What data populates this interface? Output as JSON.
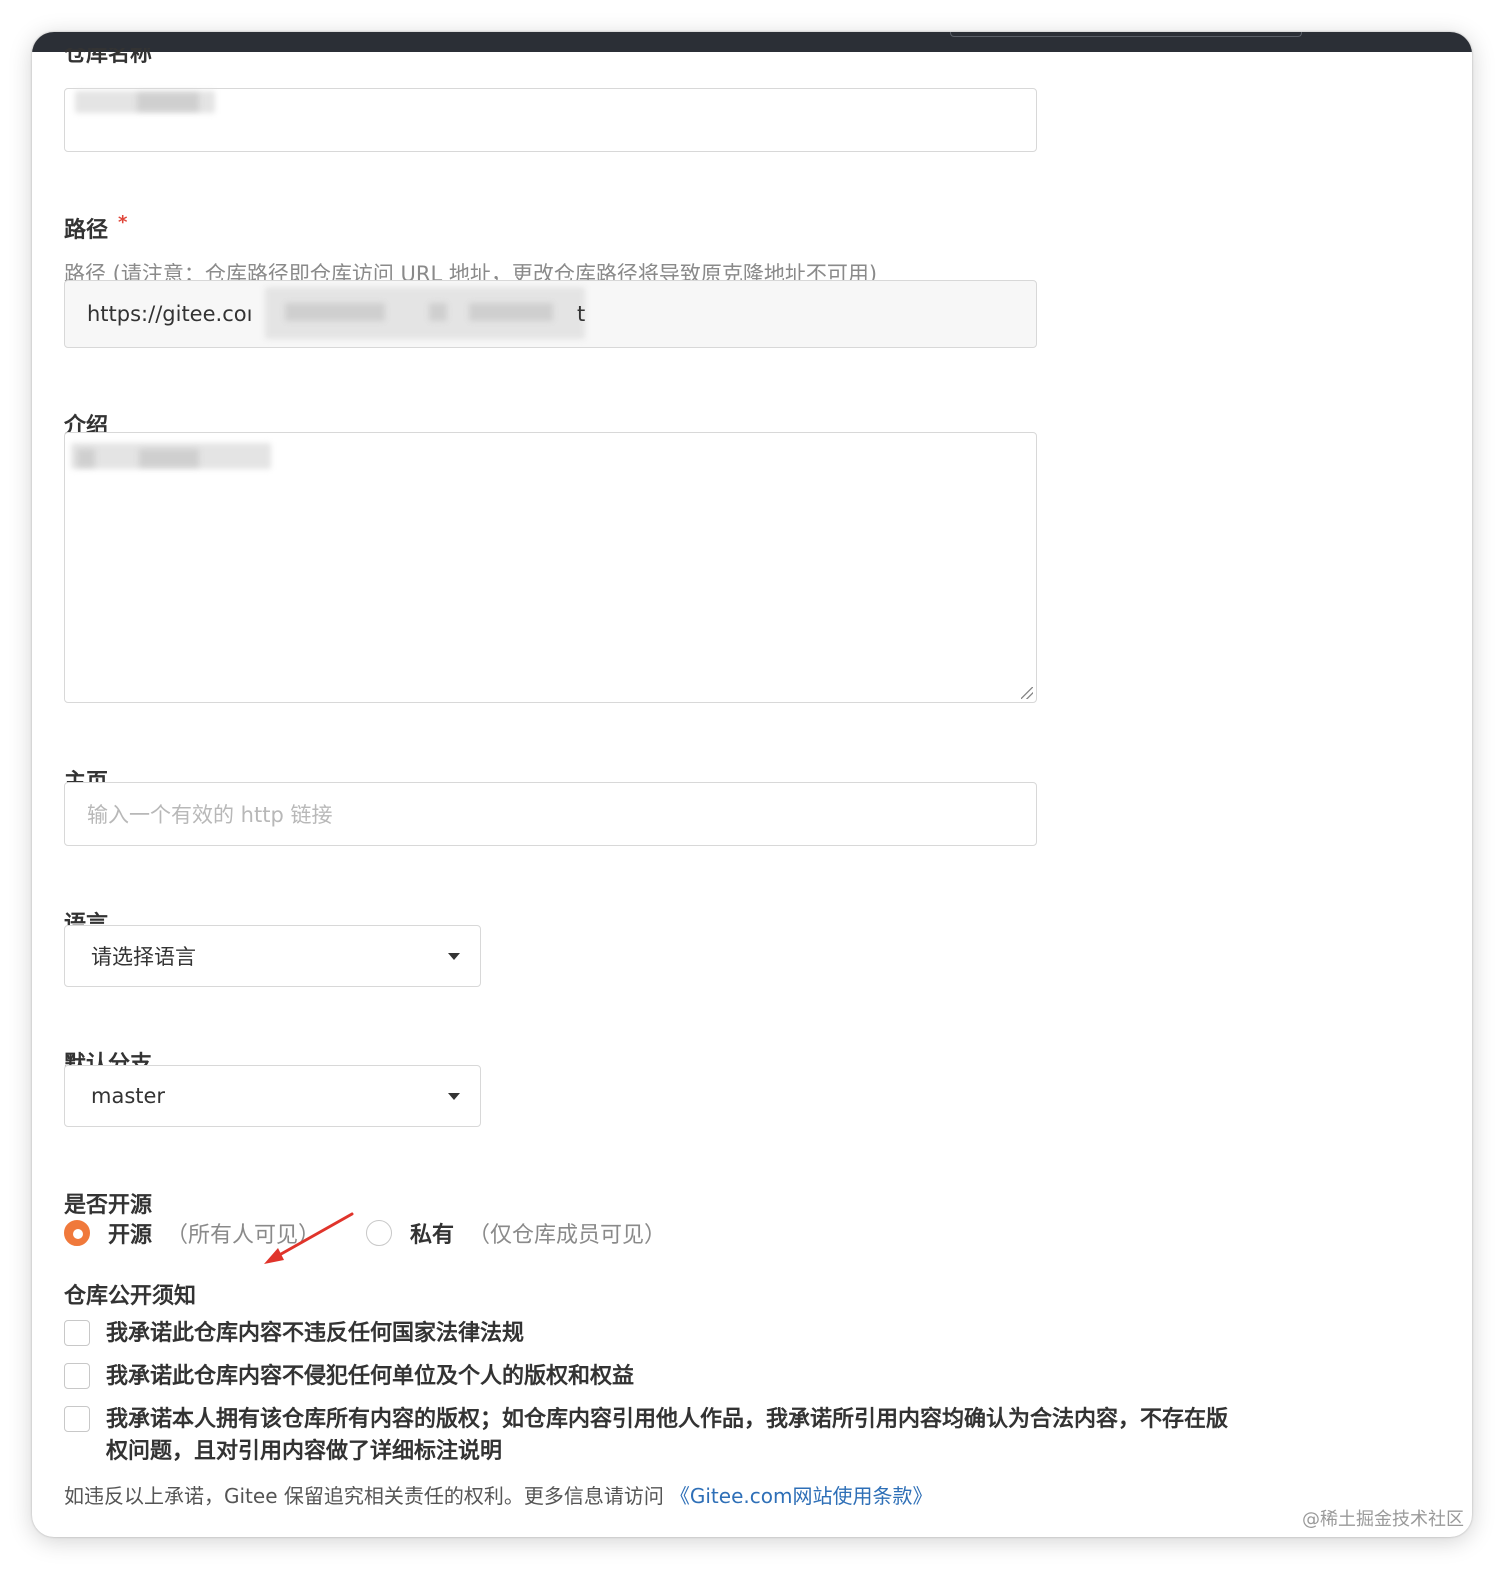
{
  "form": {
    "repo_name_label": "仓库名称",
    "path_label": "路径",
    "path_required_mark": "*",
    "path_hint": "路径 (请注意：仓库路径即仓库访问 URL 地址，更改仓库路径将导致原克隆地址不可用)",
    "path_prefix": "https://gitee.coı",
    "path_suffix": "t",
    "intro_label": "介绍",
    "homepage_label": "主页",
    "homepage_placeholder": "输入一个有效的 http 链接",
    "language_label": "语言",
    "language_selected": "请选择语言",
    "branch_label": "默认分支",
    "branch_selected": "master",
    "open_source_label": "是否开源",
    "visibility_options": [
      {
        "label": "开源",
        "note": "（所有人可见）",
        "checked": true
      },
      {
        "label": "私有",
        "note": "（仅仓库成员可见）",
        "checked": false
      }
    ],
    "notice_title": "仓库公开须知",
    "pledges": [
      "我承诺此仓库内容不违反任何国家法律法规",
      "我承诺此仓库内容不侵犯任何单位及个人的版权和权益",
      "我承诺本人拥有该仓库所有内容的版权；如仓库内容引用他人作品，我承诺所引用内容均确认为合法内容，不存在版权问题，且对引用内容做了详细标注说明"
    ],
    "footer_text": "如违反以上承诺，Gitee 保留追究相关责任的权利。更多信息请访问",
    "terms_link": "《Gitee.com网站使用条款》"
  },
  "colors": {
    "accent": "#f0793b",
    "link": "#2e6fb7",
    "required": "#e0463a",
    "annotation_arrow": "#e0342b"
  },
  "watermark": "@稀土掘金技术社区"
}
